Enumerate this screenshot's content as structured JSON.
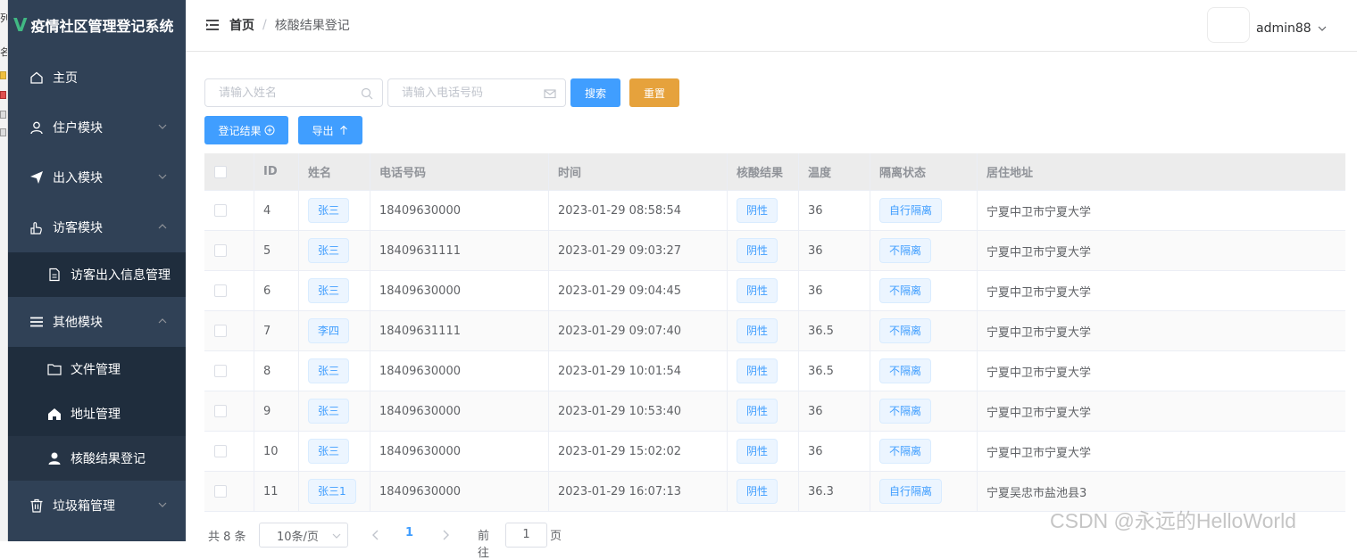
{
  "edge_fragments": [
    "列",
    "名"
  ],
  "app": {
    "title": "疫情社区管理登记系统",
    "logo": "V"
  },
  "sidebar": {
    "items": [
      {
        "label": "主页",
        "icon": "home-icon"
      },
      {
        "label": "住户模块",
        "icon": "user-icon",
        "arrow": "chevron-down-icon"
      },
      {
        "label": "出入模块",
        "icon": "send-icon",
        "arrow": "chevron-down-icon"
      },
      {
        "label": "访客模块",
        "icon": "hand-icon",
        "arrow": "chevron-up-icon"
      },
      {
        "label": "访客出入信息管理",
        "icon": "document-icon",
        "sub": true
      },
      {
        "label": "其他模块",
        "icon": "list-icon",
        "arrow": "chevron-up-icon"
      },
      {
        "label": "文件管理",
        "icon": "folder-icon",
        "sub": true
      },
      {
        "label": "地址管理",
        "icon": "house-icon",
        "sub": true
      },
      {
        "label": "核酸结果登记",
        "icon": "person-icon",
        "sub": true,
        "active": true
      },
      {
        "label": "垃圾箱管理",
        "icon": "trash-icon",
        "arrow": "chevron-down-icon"
      }
    ]
  },
  "header": {
    "breadcrumb": {
      "home": "首页",
      "separator": "/",
      "current": "核酸结果登记"
    },
    "username": "admin88"
  },
  "search": {
    "name_placeholder": "请输入姓名",
    "phone_placeholder": "请输入电话号码",
    "search_label": "搜索",
    "reset_label": "重置",
    "register_label": "登记结果",
    "export_label": "导出"
  },
  "table": {
    "columns": [
      "ID",
      "姓名",
      "电话号码",
      "时间",
      "核酸结果",
      "温度",
      "隔离状态",
      "居住地址"
    ],
    "rows": [
      {
        "id": "4",
        "name": "张三",
        "phone": "18409630000",
        "time": "2023-01-29 08:58:54",
        "result": "阴性",
        "temp": "36",
        "isolation": "自行隔离",
        "address": "宁夏中卫市宁夏大学"
      },
      {
        "id": "5",
        "name": "张三",
        "phone": "18409631111",
        "time": "2023-01-29 09:03:27",
        "result": "阴性",
        "temp": "36",
        "isolation": "不隔离",
        "address": "宁夏中卫市宁夏大学"
      },
      {
        "id": "6",
        "name": "张三",
        "phone": "18409630000",
        "time": "2023-01-29 09:04:45",
        "result": "阴性",
        "temp": "36",
        "isolation": "不隔离",
        "address": "宁夏中卫市宁夏大学"
      },
      {
        "id": "7",
        "name": "李四",
        "phone": "18409631111",
        "time": "2023-01-29 09:07:40",
        "result": "阴性",
        "temp": "36.5",
        "isolation": "不隔离",
        "address": "宁夏中卫市宁夏大学"
      },
      {
        "id": "8",
        "name": "张三",
        "phone": "18409630000",
        "time": "2023-01-29 10:01:54",
        "result": "阴性",
        "temp": "36.5",
        "isolation": "不隔离",
        "address": "宁夏中卫市宁夏大学"
      },
      {
        "id": "9",
        "name": "张三",
        "phone": "18409630000",
        "time": "2023-01-29 10:53:40",
        "result": "阴性",
        "temp": "36",
        "isolation": "不隔离",
        "address": "宁夏中卫市宁夏大学"
      },
      {
        "id": "10",
        "name": "张三",
        "phone": "18409630000",
        "time": "2023-01-29 15:02:02",
        "result": "阴性",
        "temp": "36",
        "isolation": "不隔离",
        "address": "宁夏中卫市宁夏大学"
      },
      {
        "id": "11",
        "name": "张三1",
        "phone": "18409630000",
        "time": "2023-01-29 16:07:13",
        "result": "阴性",
        "temp": "36.3",
        "isolation": "自行隔离",
        "address": "宁夏吴忠市盐池县3"
      }
    ]
  },
  "pagination": {
    "total": "共 8 条",
    "page_size": "10条/页",
    "current_page": "1",
    "goto_label": "前往",
    "goto_value": "1",
    "page_unit": "页"
  },
  "watermark": "CSDN @永远的HelloWorld",
  "colors": {
    "sidebar_bg": "#304156",
    "primary": "#409eff",
    "warning": "#e6a23c",
    "logo": "#41b883"
  }
}
